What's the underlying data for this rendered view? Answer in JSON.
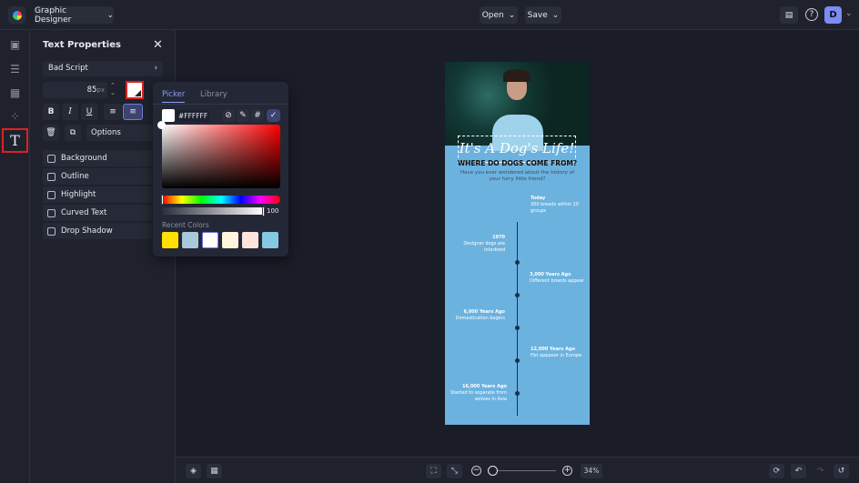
{
  "topbar": {
    "app_dropdown": "Graphic Designer",
    "open": "Open",
    "save": "Save",
    "avatar": "D"
  },
  "panel": {
    "title": "Text Properties",
    "font": "Bad Script",
    "size": "85",
    "size_unit": "px",
    "options": "Options",
    "checkboxes": [
      "Background",
      "Outline",
      "Highlight",
      "Curved Text",
      "Drop Shadow"
    ],
    "text_color": "#FFFFFF"
  },
  "picker": {
    "tabs": [
      "Picker",
      "Library"
    ],
    "hex": "#FFFFFF",
    "opacity": "100",
    "recent_label": "Recent Colors",
    "recent_colors": [
      "#FFE000",
      "#A9C8DA",
      "#FFFFFF",
      "#FFF5DC",
      "#FDE3DC",
      "#86C8E2"
    ]
  },
  "poster": {
    "title": "It's A Dog's Life!",
    "subtitle": "WHERE DO DOGS COME FROM?",
    "intro": "Have you ever wondered about the history of your furry little friend?",
    "events": [
      {
        "title": "Today",
        "text": "300 breeds within 10 groups",
        "side": "right"
      },
      {
        "title": "1970",
        "text": "Designer dogs are interbred",
        "side": "left"
      },
      {
        "title": "3,000 Years Ago",
        "text": "Different breeds appear",
        "side": "right"
      },
      {
        "title": "6,000 Years Ago",
        "text": "Domestication begins",
        "side": "left"
      },
      {
        "title": "12,000 Years Ago",
        "text": "Fist apppear in Europe",
        "side": "right"
      },
      {
        "title": "16,000 Years Ago",
        "text": "Started to separate from wolves in Asia",
        "side": "left"
      }
    ]
  },
  "bottom": {
    "zoom": "34%",
    "zoom_fraction": 0.05
  }
}
